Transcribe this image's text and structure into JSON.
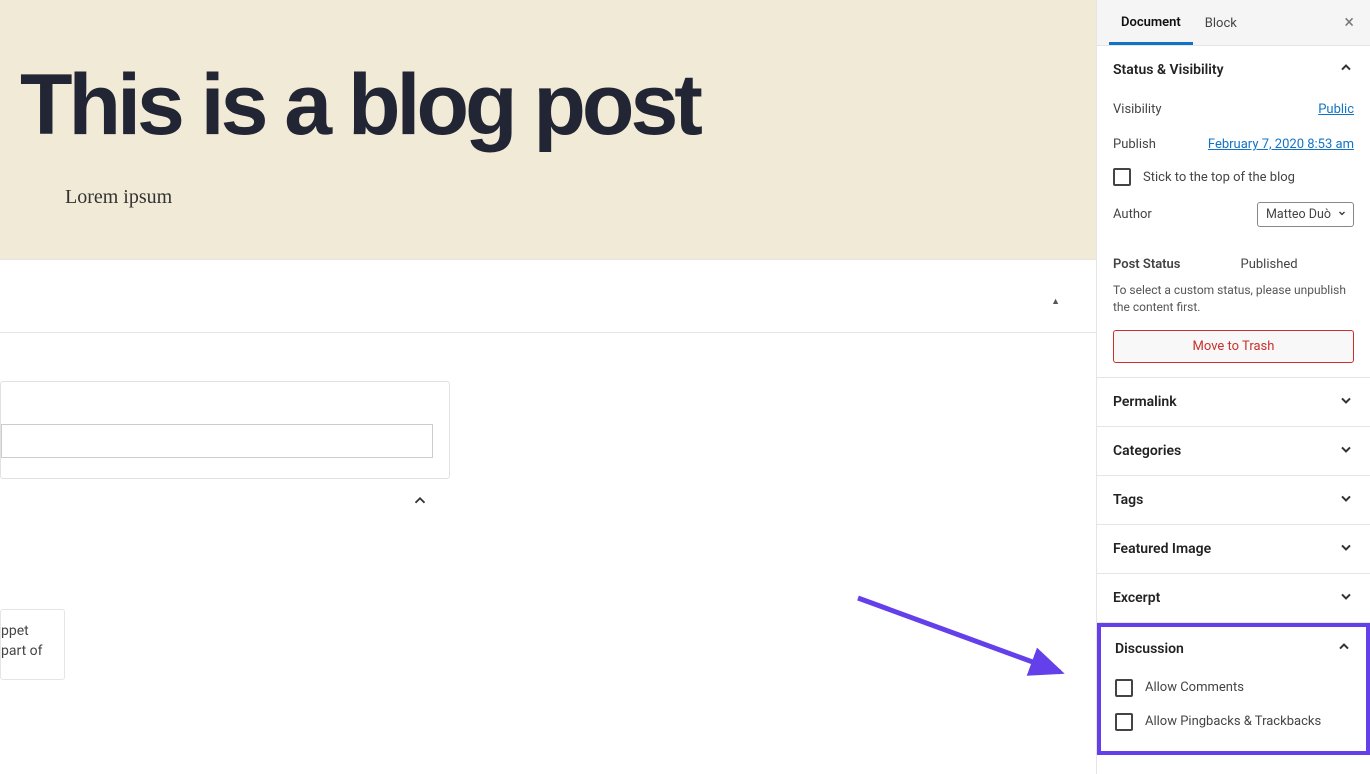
{
  "hero": {
    "title": "This is a blog post",
    "subtitle": "Lorem ipsum"
  },
  "snippet": {
    "truncated_line1": "ppet",
    "truncated_line2": "part of"
  },
  "sidebar": {
    "tabs": {
      "document": "Document",
      "block": "Block"
    },
    "status_visibility": {
      "title": "Status & Visibility",
      "visibility_label": "Visibility",
      "visibility_value": "Public",
      "publish_label": "Publish",
      "publish_value": "February 7, 2020 8:53 am",
      "stick_label": "Stick to the top of the blog",
      "author_label": "Author",
      "author_value": "Matteo Duò",
      "post_status_label": "Post Status",
      "post_status_value": "Published",
      "status_note": "To select a custom status, please unpublish the content first.",
      "trash_label": "Move to Trash"
    },
    "panels": {
      "permalink": "Permalink",
      "categories": "Categories",
      "tags": "Tags",
      "featured_image": "Featured Image",
      "excerpt": "Excerpt",
      "discussion": "Discussion"
    },
    "discussion": {
      "allow_comments": "Allow Comments",
      "allow_pingbacks": "Allow Pingbacks & Trackbacks"
    }
  }
}
